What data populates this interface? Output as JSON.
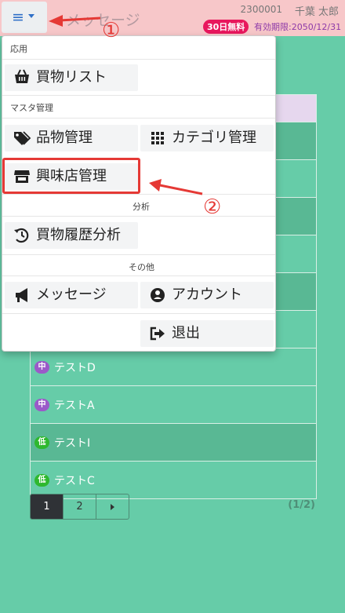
{
  "header": {
    "page_title": "メッセージ",
    "user_id": "2300001",
    "user_name": "千葉 太郎",
    "badge": "30日無料",
    "expiry": "有効期限:2050/12/31"
  },
  "annotations": {
    "step1": "①",
    "step2": "②",
    "accent_color": "#e53935"
  },
  "menu": {
    "section_app": "応用",
    "shopping_list": "買物リスト",
    "section_master": "マスタ管理",
    "item_manage": "品物管理",
    "category_manage": "カテゴリ管理",
    "shop_manage": "興味店管理",
    "section_analysis": "分析",
    "history_analysis": "買物履歴分析",
    "section_other": "その他",
    "message": "メッセージ",
    "account": "アカウント",
    "logout": "退出"
  },
  "table": {
    "rows": [
      {
        "priority": "中",
        "label": "テストD"
      },
      {
        "priority": "中",
        "label": "テストA"
      },
      {
        "priority": "低",
        "label": "テストI"
      },
      {
        "priority": "低",
        "label": "テストC"
      }
    ]
  },
  "pagination": {
    "page1": "1",
    "page2": "2",
    "counter": "(1/2)"
  },
  "colors": {
    "background": "#66cca8",
    "header": "#f7c7c9",
    "badge": "#e8175d",
    "priority_mid": "#9b59c9",
    "priority_low": "#2eb82e"
  }
}
